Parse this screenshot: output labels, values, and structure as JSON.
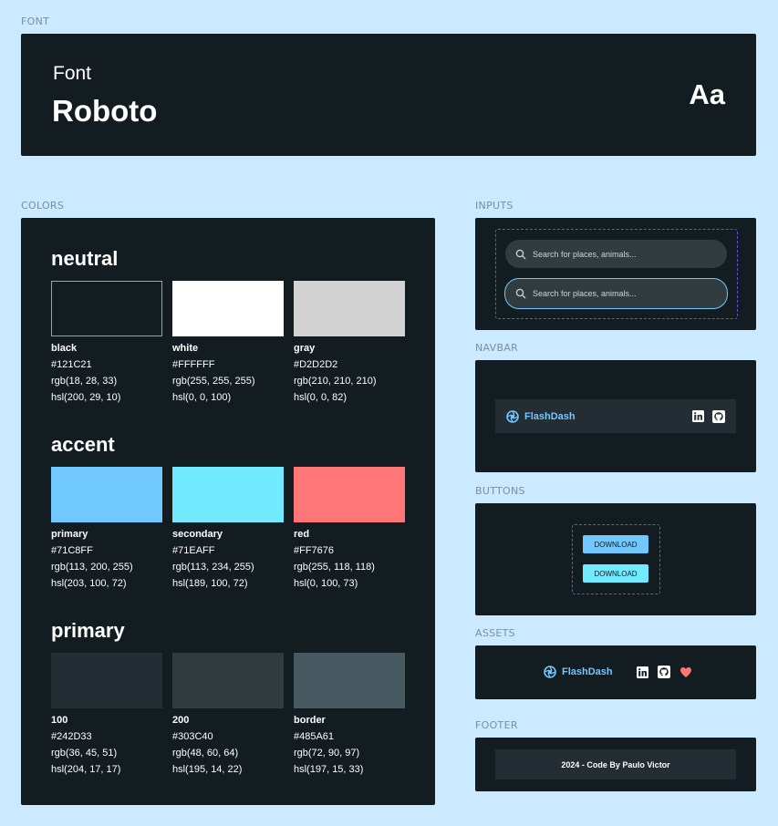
{
  "sections": {
    "font": "FONT",
    "colors": "COLORS",
    "inputs": "INPUTS",
    "navbar": "NAVBAR",
    "buttons": "BUTTONS",
    "assets": "ASSETS",
    "footer": "FOOTER"
  },
  "font_panel": {
    "label": "Font",
    "name": "Roboto",
    "sample": "Aa"
  },
  "color_groups": [
    {
      "title": "neutral",
      "swatches": [
        {
          "name": "black",
          "hex": "#121C21",
          "rgb": "rgb(18, 28, 33)",
          "hsl": "hsl(200, 29, 10)",
          "color": "#121C21"
        },
        {
          "name": "white",
          "hex": "#FFFFFF",
          "rgb": "rgb(255, 255, 255)",
          "hsl": "hsl(0, 0, 100)",
          "color": "#FFFFFF"
        },
        {
          "name": "gray",
          "hex": "#D2D2D2",
          "rgb": "rgb(210, 210, 210)",
          "hsl": "hsl(0, 0, 82)",
          "color": "#D2D2D2"
        }
      ]
    },
    {
      "title": "accent",
      "swatches": [
        {
          "name": "primary",
          "hex": "#71C8FF",
          "rgb": "rgb(113, 200, 255)",
          "hsl": "hsl(203, 100, 72)",
          "color": "#71C8FF"
        },
        {
          "name": "secondary",
          "hex": "#71EAFF",
          "rgb": "rgb(113, 234, 255)",
          "hsl": "hsl(189, 100, 72)",
          "color": "#71EAFF"
        },
        {
          "name": "red",
          "hex": "#FF7676",
          "rgb": "rgb(255, 118, 118)",
          "hsl": "hsl(0, 100, 73)",
          "color": "#FF7676"
        }
      ]
    },
    {
      "title": "primary",
      "swatches": [
        {
          "name": "100",
          "hex": "#242D33",
          "rgb": "rgb(36, 45, 51)",
          "hsl": "hsl(204, 17, 17)",
          "color": "#242D33"
        },
        {
          "name": "200",
          "hex": "#303C40",
          "rgb": "rgb(48, 60, 64)",
          "hsl": "hsl(195, 14, 22)",
          "color": "#303C40"
        },
        {
          "name": "border",
          "hex": "#485A61",
          "rgb": "rgb(72, 90, 97)",
          "hsl": "hsl(197, 15, 33)",
          "color": "#485A61"
        }
      ]
    }
  ],
  "inputs": {
    "search_placeholder": "Search for places, animals...",
    "search_placeholder_focused": "Search for places, animals..."
  },
  "navbar": {
    "brand": "FlashDash"
  },
  "buttons": {
    "primary_label": "DOWNLOAD",
    "secondary_label": "DOWNLOAD"
  },
  "assets": {
    "brand": "FlashDash"
  },
  "footer": {
    "text": "2024 - Code By Paulo Victor"
  },
  "icons": [
    "aperture-logo-icon",
    "linkedin-icon",
    "github-icon",
    "heart-icon",
    "search-icon"
  ]
}
